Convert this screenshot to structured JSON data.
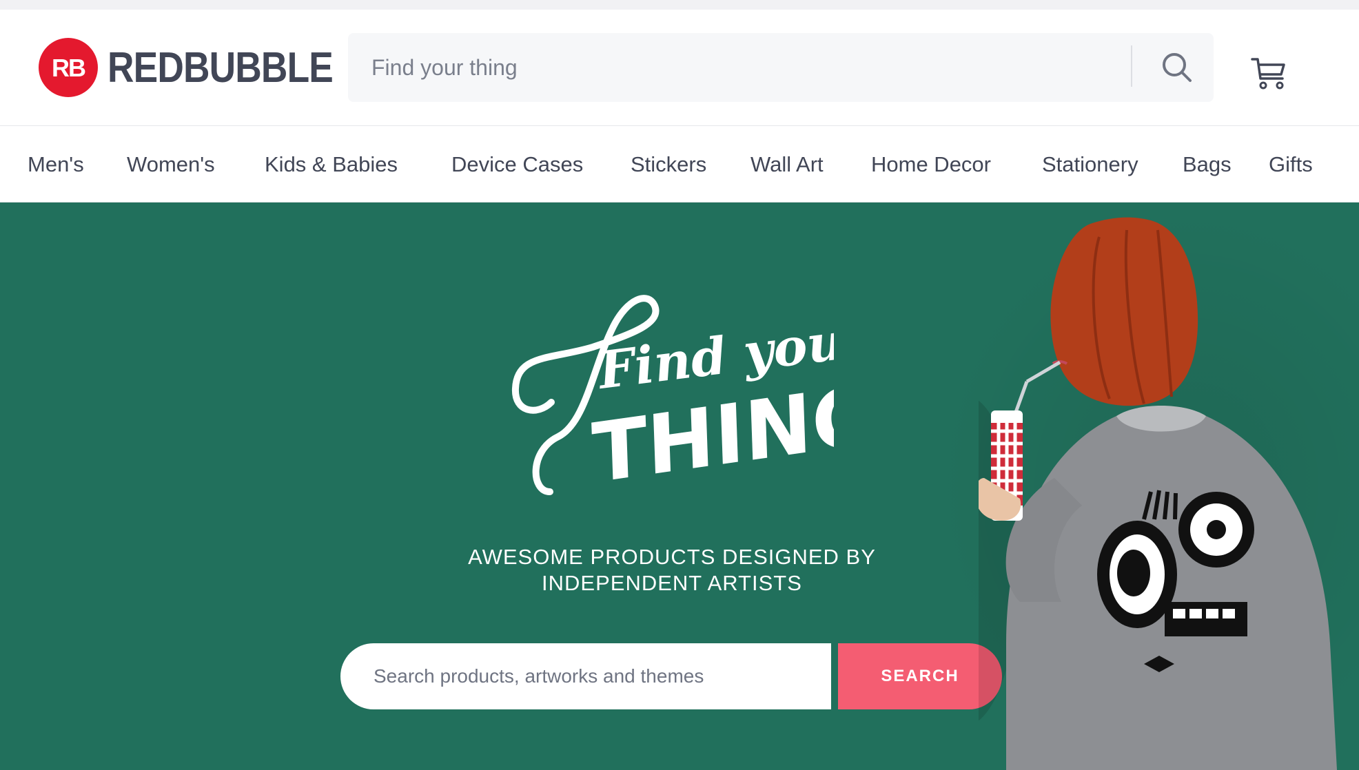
{
  "header": {
    "brand": "REDBUBBLE",
    "logo_mark_text": "RB",
    "search_placeholder": "Find your thing",
    "search_icon": "search-icon",
    "cart_icon": "cart-icon"
  },
  "nav": {
    "items": [
      {
        "label": "Men's"
      },
      {
        "label": "Women's"
      },
      {
        "label": "Kids & Babies"
      },
      {
        "label": "Device Cases"
      },
      {
        "label": "Stickers"
      },
      {
        "label": "Wall Art"
      },
      {
        "label": "Home Decor"
      },
      {
        "label": "Stationery"
      },
      {
        "label": "Bags"
      },
      {
        "label": "Gifts"
      }
    ]
  },
  "hero": {
    "lettering_line1": "Find your",
    "lettering_line2": "THING",
    "tagline_line1": "AWESOME PRODUCTS DESIGNED BY",
    "tagline_line2": "INDEPENDENT ARTISTS",
    "search_placeholder": "Search products, artworks and themes",
    "search_button": "SEARCH"
  },
  "colors": {
    "brand_red": "#e4192e",
    "hero_green": "#21705c",
    "search_button": "#f45d72",
    "nav_text": "#414656"
  }
}
